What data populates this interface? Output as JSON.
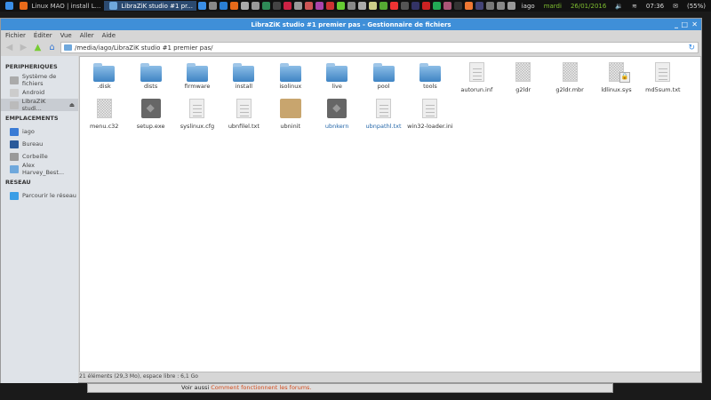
{
  "taskbar": {
    "tasks": [
      "Linux MAO | install L...",
      "LibraZiK studio #1 pr..."
    ],
    "user": "iago",
    "day": "mardi",
    "date": "26/01/2016",
    "time": "07:36",
    "battery": "(55%)",
    "tray_colors": [
      "#3a8ee6",
      "#888",
      "#2a7fd4",
      "#e86a1a",
      "#aaa",
      "#999",
      "#2e8b57",
      "#444",
      "#c24",
      "#999",
      "#c55",
      "#a4a",
      "#c33",
      "#6c3",
      "#888",
      "#aaa",
      "#cc8",
      "#5a3",
      "#e33",
      "#555",
      "#336",
      "#c22",
      "#2a5",
      "#a57",
      "#333",
      "#e73",
      "#447",
      "#777",
      "#888",
      "#999"
    ]
  },
  "window": {
    "title": "LibraZiK studio #1 premier pas - Gestionnaire de fichiers",
    "menu": [
      "Fichier",
      "Éditer",
      "Vue",
      "Aller",
      "Aide"
    ],
    "path": "/media/iago/LibraZiK studio #1 premier pas/"
  },
  "sidebar": {
    "sections": [
      {
        "title": "PERIPHERIQUES",
        "items": [
          {
            "label": "Système de fichiers",
            "color": "#aaa"
          },
          {
            "label": "Android",
            "color": "#ccc"
          },
          {
            "label": "LibraZiK studi...",
            "color": "#bbb",
            "selected": true,
            "eject": "⏏"
          }
        ]
      },
      {
        "title": "EMPLACEMENTS",
        "items": [
          {
            "label": "iago",
            "color": "#3a7bd5"
          },
          {
            "label": "Bureau",
            "color": "#2a5a9a"
          },
          {
            "label": "Corbeille",
            "color": "#999"
          },
          {
            "label": "Alex Harvey_Best...",
            "color": "#6fa8dc"
          }
        ]
      },
      {
        "title": "RESEAU",
        "items": [
          {
            "label": "Parcourir le réseau",
            "color": "#3a9ee6"
          }
        ]
      }
    ]
  },
  "files": [
    {
      "name": ".disk",
      "type": "folder"
    },
    {
      "name": "dists",
      "type": "folder"
    },
    {
      "name": "firmware",
      "type": "folder"
    },
    {
      "name": "install",
      "type": "folder"
    },
    {
      "name": "isolinux",
      "type": "folder"
    },
    {
      "name": "live",
      "type": "folder"
    },
    {
      "name": "pool",
      "type": "folder"
    },
    {
      "name": "tools",
      "type": "folder"
    },
    {
      "name": "autorun.inf",
      "type": "doc"
    },
    {
      "name": "g2ldr",
      "type": "bin"
    },
    {
      "name": "g2ldr.mbr",
      "type": "bin"
    },
    {
      "name": "ldlinux.sys",
      "type": "bin",
      "locked": true
    },
    {
      "name": "md5sum.txt",
      "type": "doc"
    },
    {
      "name": "menu.c32",
      "type": "bin"
    },
    {
      "name": "setup.exe",
      "type": "exe"
    },
    {
      "name": "syslinux.cfg",
      "type": "doc"
    },
    {
      "name": "ubnfilel.txt",
      "type": "doc"
    },
    {
      "name": "ubninit",
      "type": "box"
    },
    {
      "name": "ubnkern",
      "type": "exe",
      "blue": true
    },
    {
      "name": "ubnpathl.txt",
      "type": "doc",
      "blue": true
    },
    {
      "name": "win32-loader.ini",
      "type": "doc"
    }
  ],
  "status": "21 éléments (29,3 Mo), espace libre : 6,1 Go",
  "behind": {
    "prefix": "Voir aussi",
    "link": "Comment fonctionnent les forums."
  }
}
